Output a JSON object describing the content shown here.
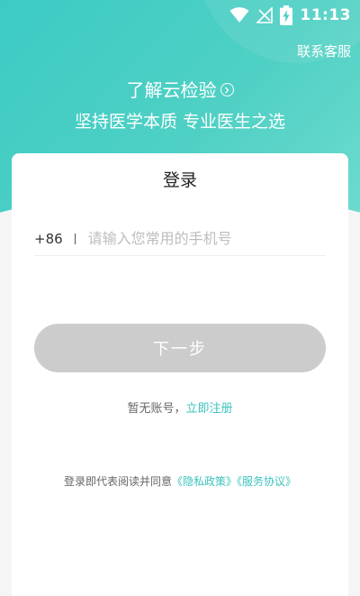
{
  "status_bar": {
    "time": "11:13"
  },
  "header": {
    "service_link": "联系客服",
    "about_link": "了解云检验",
    "slogan": "坚持医学本质 专业医生之选"
  },
  "login": {
    "title": "登录",
    "country_code": "+86",
    "phone_placeholder": "请输入您常用的手机号",
    "next_button": "下一步",
    "no_account_text": "暂无账号，",
    "register_link": "立即注册",
    "agreement_prefix": "登录即代表阅读并同意",
    "privacy_link": "《隐私政策》",
    "service_agreement_link": "《服务协议》"
  },
  "colors": {
    "brand_teal": "#3ccbc4",
    "link_teal": "#3cc3bd",
    "disabled_button": "#cccccc"
  },
  "icons": [
    "wifi-icon",
    "no-signal-icon",
    "battery-charging-icon",
    "chevron-right-circle-icon"
  ]
}
